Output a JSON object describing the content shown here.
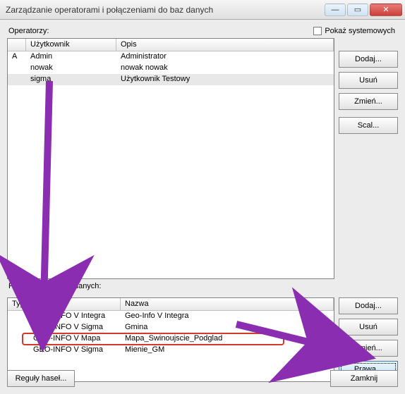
{
  "window": {
    "title": "Zarządzanie operatorami i połączeniami do baz danych"
  },
  "operators": {
    "label": "Operatorzy:",
    "show_system_label": "Pokaż systemowych",
    "columns": {
      "c0": "",
      "c1": "Użytkownik",
      "c2": "Opis"
    },
    "rows": [
      {
        "c0": "A",
        "c1": "Admin",
        "c2": "Administrator",
        "sel": false
      },
      {
        "c0": "",
        "c1": "nowak",
        "c2": "nowak nowak",
        "sel": false
      },
      {
        "c0": "",
        "c1": "sigma",
        "c2": "Użytkownik Testowy",
        "sel": true
      }
    ],
    "buttons": {
      "add": "Dodaj...",
      "del": "Usuń",
      "edit": "Zmień...",
      "merge": "Scal..."
    }
  },
  "connections": {
    "label": "Połączenia do baz danych:",
    "columns": {
      "c0": "Typ",
      "c1": "Programu",
      "c2": "Nazwa"
    },
    "rows": [
      {
        "c1": "GEO-INFO V Integra",
        "c2": "Geo-Info V Integra",
        "hl": false
      },
      {
        "c1": "GEO-INFO V Sigma",
        "c2": "Gmina",
        "hl": false
      },
      {
        "c1": "GEO-INFO V Mapa",
        "c2": "Mapa_Swinoujscie_Podglad",
        "hl": true
      },
      {
        "c1": "GEO-INFO V Sigma",
        "c2": "Mienie_GM",
        "hl": false
      }
    ],
    "buttons": {
      "add": "Dodaj...",
      "del": "Usuń",
      "edit": "Zmień...",
      "rights": "Prawa..."
    }
  },
  "footer": {
    "rules": "Reguły haseł...",
    "close": "Zamknij"
  }
}
